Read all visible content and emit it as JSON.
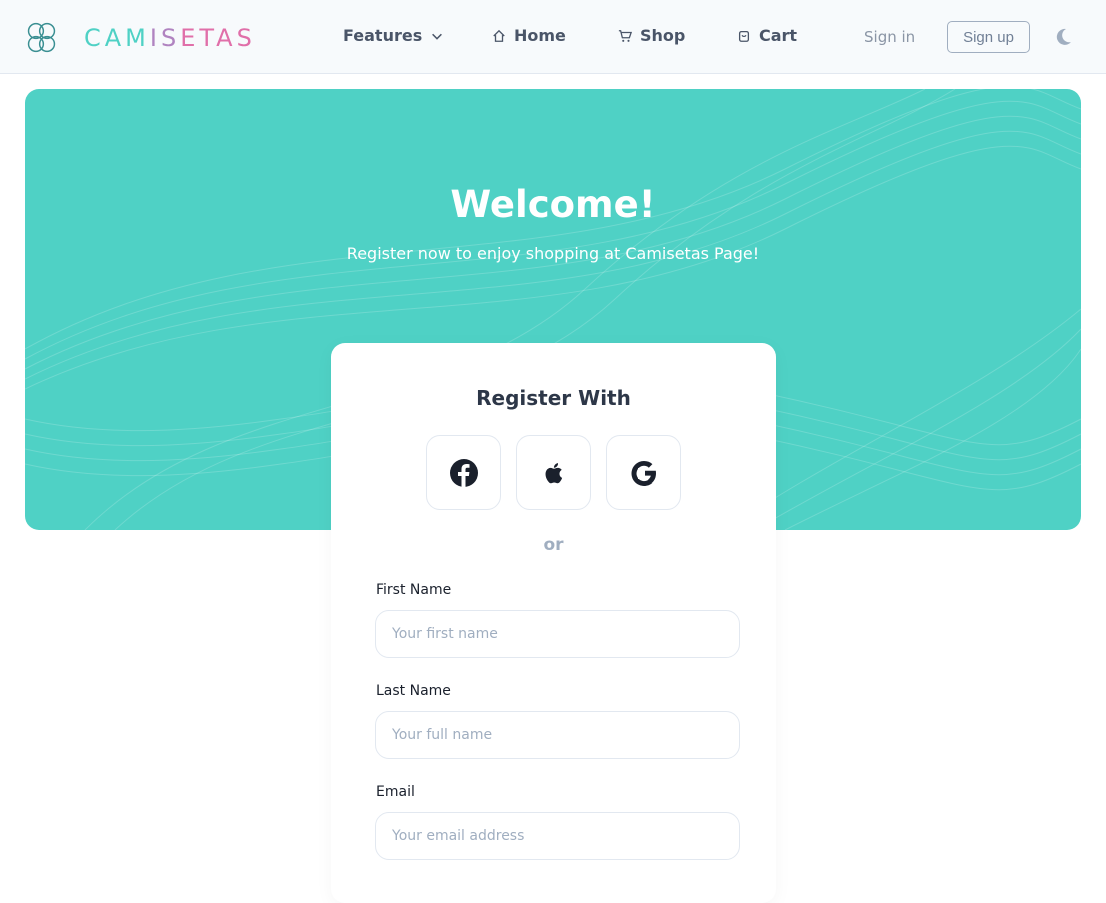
{
  "brand": {
    "name_part1": "CAM",
    "name_part2": "IS",
    "name_part3": "ETAS"
  },
  "nav": {
    "features": "Features",
    "home": "Home",
    "shop": "Shop",
    "cart": "Cart",
    "sign_in": "Sign in",
    "sign_up": "Sign up"
  },
  "hero": {
    "title": "Welcome!",
    "subtitle": "Register now to enjoy shopping at Camisetas Page!"
  },
  "register": {
    "title": "Register With",
    "or": "or",
    "first_name_label": "First Name",
    "first_name_placeholder": "Your first name",
    "last_name_label": "Last Name",
    "last_name_placeholder": "Your full name",
    "email_label": "Email",
    "email_placeholder": "Your email address"
  },
  "icons": {
    "logo": "logo-icon",
    "features": "chevron-down-icon",
    "home": "home-icon",
    "shop": "cart-icon",
    "cart": "bag-icon",
    "theme": "moon-icon",
    "facebook": "facebook-icon",
    "apple": "apple-icon",
    "google": "google-icon"
  },
  "colors": {
    "brand_teal": "#4fd1c5",
    "brand_purple": "#b083c0",
    "brand_pink": "#e06fa9",
    "hero_bg": "#4fd1c5"
  }
}
